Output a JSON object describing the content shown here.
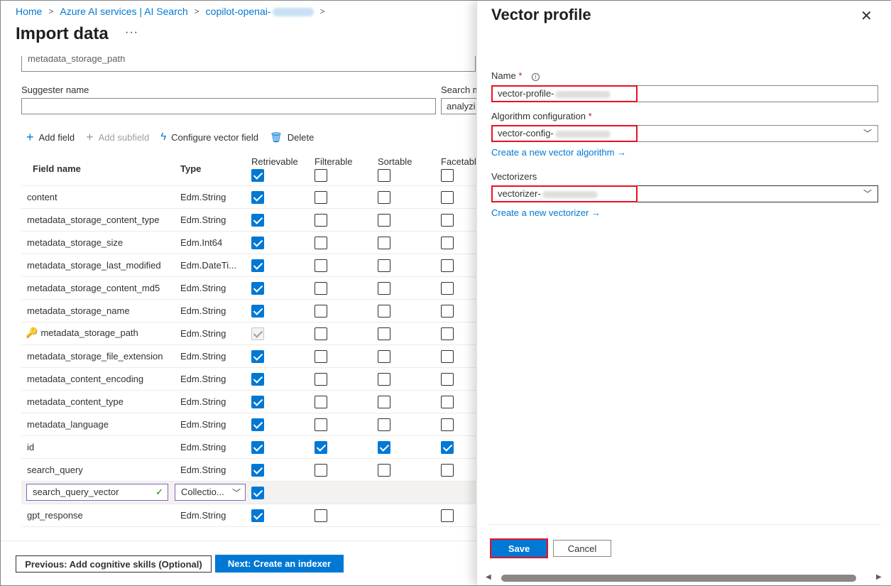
{
  "breadcrumb": {
    "items": [
      "Home",
      "Azure AI services | AI Search",
      "copilot-openai-"
    ]
  },
  "page": {
    "title": "Import data",
    "more": "···"
  },
  "form": {
    "previous_field_value": "metadata_storage_path",
    "suggester_label": "Suggester name",
    "suggester_value": "",
    "search_mode_label": "Search m",
    "search_mode_value": "analyzi"
  },
  "toolbar": {
    "add_field": "Add field",
    "add_subfield": "Add subfield",
    "configure_vector_field": "Configure vector field",
    "delete": "Delete"
  },
  "table": {
    "headers": {
      "field_name": "Field name",
      "type": "Type",
      "retrievable": "Retrievable",
      "filterable": "Filterable",
      "sortable": "Sortable",
      "facetable": "Facetable"
    },
    "rows": [
      {
        "name": "content",
        "type": "Edm.String"
      },
      {
        "name": "metadata_storage_content_type",
        "type": "Edm.String"
      },
      {
        "name": "metadata_storage_size",
        "type": "Edm.Int64"
      },
      {
        "name": "metadata_storage_last_modified",
        "type": "Edm.DateTi..."
      },
      {
        "name": "metadata_storage_content_md5",
        "type": "Edm.String"
      },
      {
        "name": "metadata_storage_name",
        "type": "Edm.String"
      },
      {
        "name": "metadata_storage_path",
        "type": "Edm.String"
      },
      {
        "name": "metadata_storage_file_extension",
        "type": "Edm.String"
      },
      {
        "name": "metadata_content_encoding",
        "type": "Edm.String"
      },
      {
        "name": "metadata_content_type",
        "type": "Edm.String"
      },
      {
        "name": "metadata_language",
        "type": "Edm.String"
      },
      {
        "name": "id",
        "type": "Edm.String"
      },
      {
        "name": "search_query",
        "type": "Edm.String"
      },
      {
        "name": "search_query_vector",
        "type": "Collectio..."
      },
      {
        "name": "gpt_response",
        "type": "Edm.String"
      }
    ]
  },
  "footer": {
    "previous_button": "Previous: Add cognitive skills (Optional)",
    "next_button": "Next: Create an indexer"
  },
  "panel": {
    "title": "Vector profile",
    "name_label": "Name",
    "name_value": "vector-profile-",
    "algorithm_label": "Algorithm configuration",
    "algorithm_value": "vector-config-",
    "create_algorithm_link": "Create a new vector algorithm →",
    "vectorizers_label": "Vectorizers",
    "vectorizer_value": "vectorizer-",
    "create_vectorizer_link": "Create a new vectorizer →",
    "save_button": "Save",
    "cancel_button": "Cancel",
    "required_mark": "*",
    "info_glyph": "i"
  },
  "colors": {
    "accent": "#0078d4",
    "highlight_box": "#e81123"
  }
}
